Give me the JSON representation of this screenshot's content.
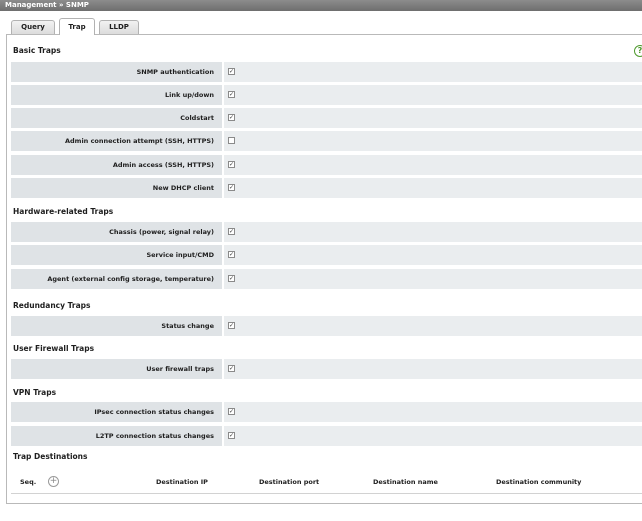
{
  "header": {
    "breadcrumb": "Management » SNMP"
  },
  "tabs": [
    {
      "label": "Query",
      "active": false
    },
    {
      "label": "Trap",
      "active": true
    },
    {
      "label": "LLDP",
      "active": false
    }
  ],
  "help_icon": "help-icon",
  "sections": {
    "basic": {
      "title": "Basic Traps",
      "rows": [
        {
          "label": "SNMP authentication",
          "checked": true
        },
        {
          "label": "Link up/down",
          "checked": true
        },
        {
          "label": "Coldstart",
          "checked": true
        },
        {
          "label": "Admin connection attempt (SSH, HTTPS)",
          "checked": false
        },
        {
          "label": "Admin access (SSH, HTTPS)",
          "checked": true
        },
        {
          "label": "New DHCP client",
          "checked": true
        }
      ]
    },
    "hardware": {
      "title": "Hardware-related Traps",
      "rows": [
        {
          "label": "Chassis (power, signal relay)",
          "checked": true
        },
        {
          "label": "Service input/CMD",
          "checked": true
        },
        {
          "label": "Agent (external config storage, temperature)",
          "checked": true
        }
      ]
    },
    "redundancy": {
      "title": "Redundancy Traps",
      "rows": [
        {
          "label": "Status change",
          "checked": true
        }
      ]
    },
    "firewall": {
      "title": "User Firewall Traps",
      "rows": [
        {
          "label": "User firewall traps",
          "checked": true
        }
      ]
    },
    "vpn": {
      "title": "VPN Traps",
      "rows": [
        {
          "label": "IPsec connection status changes",
          "checked": true
        },
        {
          "label": "L2TP connection status changes",
          "checked": true
        }
      ]
    }
  },
  "destinations": {
    "title": "Trap Destinations",
    "columns": [
      "Seq.",
      "Destination IP",
      "Destination port",
      "Destination name",
      "Destination community"
    ],
    "add_icon": "plus-circle-icon"
  }
}
